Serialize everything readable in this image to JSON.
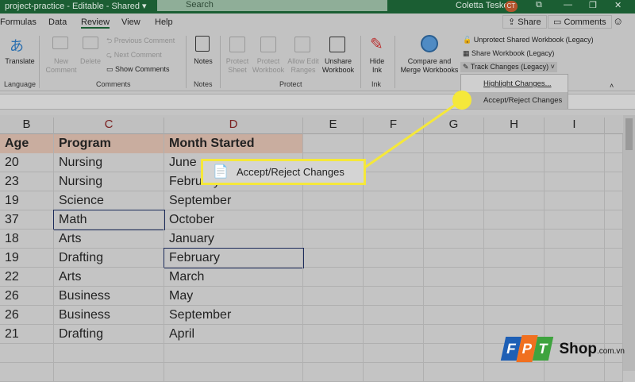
{
  "titlebar": {
    "doc": "project-practice - Editable  -  Shared ▾",
    "search": "Search",
    "user": "Coletta Teske",
    "initials": "CT"
  },
  "tabs": [
    "Formulas",
    "Data",
    "Review",
    "View",
    "Help"
  ],
  "share": "Share",
  "comments": "Comments",
  "ribbon": {
    "translate": "Translate",
    "language": "Language",
    "new_comment": "New Comment",
    "delete": "Delete",
    "previous_comment": "Previous Comment",
    "next_comment": "Next Comment",
    "show_comments": "Show Comments",
    "comments_group": "Comments",
    "notes": "Notes",
    "notes_group": "Notes",
    "protect_sheet": "Protect Sheet",
    "protect_workbook": "Protect Workbook",
    "allow_edit": "Allow Edit Ranges",
    "unshare": "Unshare Workbook",
    "protect_group": "Protect",
    "hide_ink": "Hide Ink",
    "ink_group": "Ink",
    "compare": "Compare and Merge Workbooks",
    "unprotect_shared": "Unprotect Shared Workbook (Legacy)",
    "share_workbook": "Share Workbook (Legacy)",
    "track_changes": "Track Changes (Legacy)"
  },
  "menu": {
    "highlight": "Highlight Changes...",
    "accept": "Accept/Reject Changes"
  },
  "callout": "Accept/Reject Changes",
  "columns": [
    "B",
    "C",
    "D",
    "E",
    "F",
    "G",
    "H",
    "I"
  ],
  "header": [
    "Age",
    "Program",
    "Month Started"
  ],
  "rows": [
    [
      "20",
      "Nursing",
      "June"
    ],
    [
      "23",
      "Nursing",
      "February"
    ],
    [
      "19",
      "Science",
      "September"
    ],
    [
      "37",
      "Math",
      "October"
    ],
    [
      "18",
      "Arts",
      "January"
    ],
    [
      "19",
      "Drafting",
      "February"
    ],
    [
      "22",
      "Arts",
      "March"
    ],
    [
      "26",
      "Business",
      "May"
    ],
    [
      "26",
      "Business",
      "September"
    ],
    [
      "21",
      "Drafting",
      "April"
    ]
  ],
  "watermark": {
    "brand": "FPT",
    "shop": "Shop",
    "domain": ".com.vn"
  },
  "colors": {
    "title": "#1b5e33",
    "highlight": "#f5e83a",
    "header_row": "#c9ad9f"
  }
}
